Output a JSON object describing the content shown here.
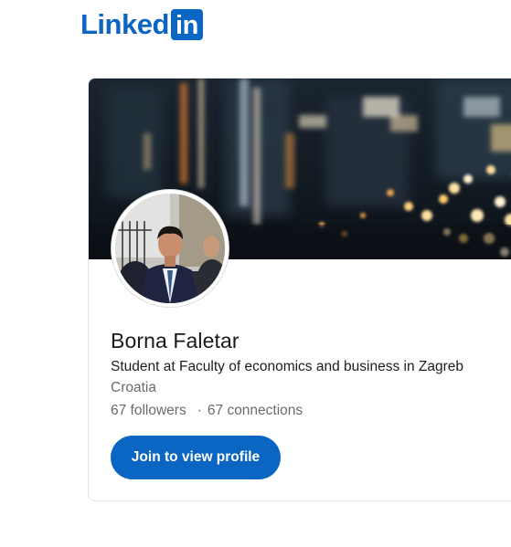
{
  "logo": {
    "text": "Linked",
    "box_text": "in",
    "color": "#0a66c2"
  },
  "profile": {
    "name": "Borna Faletar",
    "headline": "Student at Faculty of economics and business in Zagreb",
    "location": "Croatia",
    "followers": "67 followers",
    "separator": "·",
    "connections": "67 connections"
  },
  "actions": {
    "join_label": "Join to view profile"
  },
  "colors": {
    "brand": "#0a66c2",
    "text_primary": "#191919",
    "text_secondary": "#6b6b6b"
  }
}
